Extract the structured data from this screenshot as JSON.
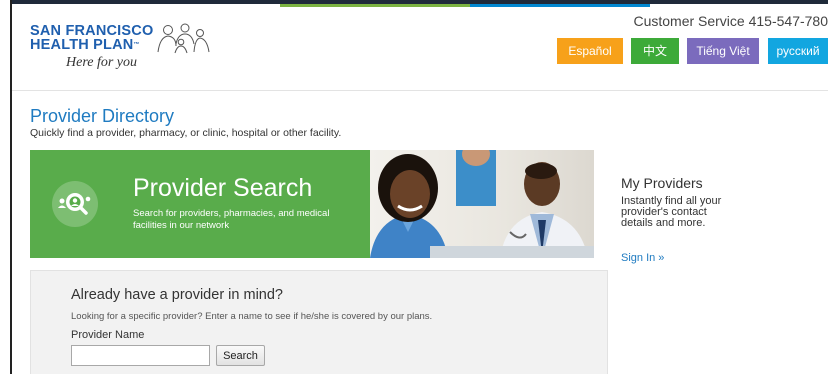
{
  "header": {
    "logo_line1": "SAN FRANCISCO",
    "logo_line2": "HEALTH PLAN",
    "logo_trademark": "™",
    "logo_tagline": "Here for you",
    "customer_service": "Customer Service 415-547-780",
    "languages": [
      {
        "label": "Español",
        "color": "#f7a11a"
      },
      {
        "label": "中文",
        "color": "#3daa39"
      },
      {
        "label": "Tiếng Việt",
        "color": "#7b6bbd"
      },
      {
        "label": "русский",
        "color": "#12a6e0"
      }
    ]
  },
  "page": {
    "title": "Provider Directory",
    "subtitle": "Quickly find a provider, pharmacy, or clinic, hospital or other facility."
  },
  "banner": {
    "icon": "doctor-search-icon",
    "title": "Provider Search",
    "description": "Search for providers, pharmacies, and medical facilities in our network",
    "background_color": "#59ac4b"
  },
  "sidebar": {
    "title": "My Providers",
    "description": "Instantly find all your provider's contact details and more.",
    "link": "Sign In »"
  },
  "search": {
    "title": "Already have a provider in mind?",
    "subtitle": "Looking for a specific provider? Enter a name to see if he/she is covered by our plans.",
    "field_label": "Provider Name",
    "input_value": "",
    "button_label": "Search"
  }
}
